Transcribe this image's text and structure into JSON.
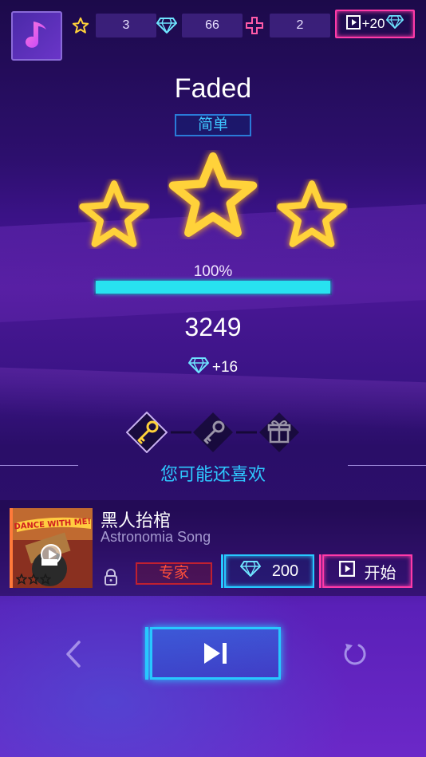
{
  "colors": {
    "accent_cyan": "#28e2f0",
    "accent_pink": "#ff3aa8",
    "star_gold": "#ffd23a",
    "expert_red": "#ff4e3a",
    "recommend_blue": "#2ec8ff"
  },
  "top_bar": {
    "app_icon": "music-note-icon",
    "stars_count": "3",
    "gems_count": "66",
    "lives_count": "2",
    "ad_reward_label": "+20"
  },
  "result": {
    "song_title": "Faded",
    "difficulty": "简单",
    "stars_earned": 3,
    "stars_total": 3,
    "progress_label": "100%",
    "progress_fraction": 1.0,
    "score": "3249",
    "gem_reward": "+16"
  },
  "keys": [
    {
      "name": "key-gold",
      "active": true
    },
    {
      "name": "key-grey",
      "active": false
    },
    {
      "name": "gift",
      "active": false
    }
  ],
  "recommend": {
    "header": "您可能还喜欢",
    "song": {
      "title": "黑人抬棺",
      "artist": "Astronomia Song",
      "difficulty": "专家",
      "price": "200",
      "start_label": "开始",
      "cover_text": "DANCE WITH ME!",
      "stars": 0
    }
  },
  "controls": {
    "back": "chevron-left-icon",
    "next": "play-next-icon",
    "replay": "replay-icon"
  }
}
